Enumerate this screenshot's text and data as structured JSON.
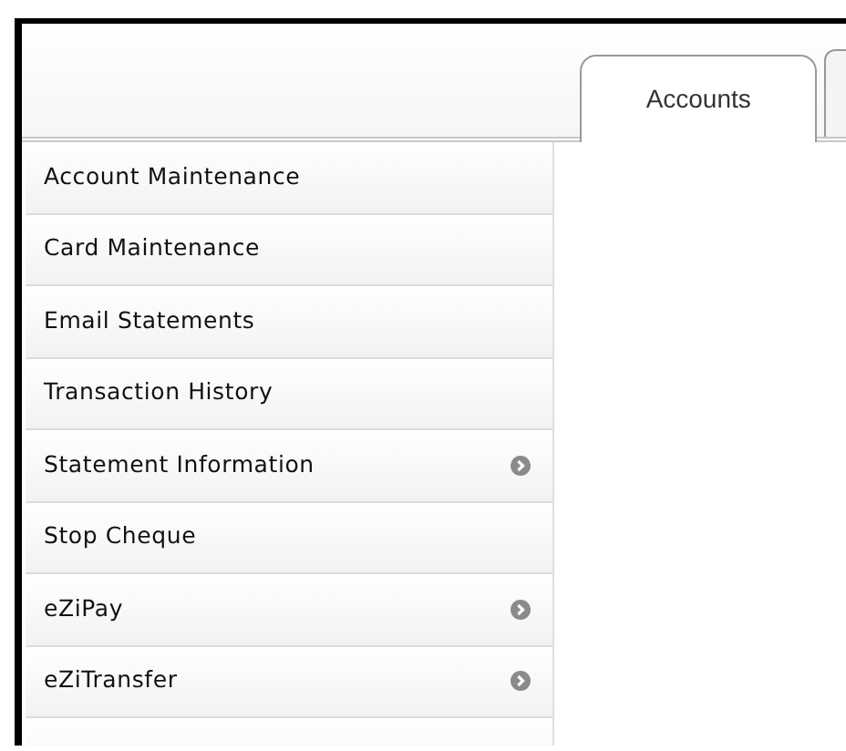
{
  "tabs": [
    {
      "label": "Accounts",
      "selected": true
    }
  ],
  "menu": [
    {
      "label": "Account Maintenance",
      "has_submenu": false
    },
    {
      "label": "Card Maintenance",
      "has_submenu": false
    },
    {
      "label": "Email Statements",
      "has_submenu": false
    },
    {
      "label": "Transaction History",
      "has_submenu": false
    },
    {
      "label": "Statement Information",
      "has_submenu": true
    },
    {
      "label": "Stop Cheque",
      "has_submenu": false
    },
    {
      "label": "eZiPay",
      "has_submenu": true
    },
    {
      "label": "eZiTransfer",
      "has_submenu": true
    }
  ]
}
